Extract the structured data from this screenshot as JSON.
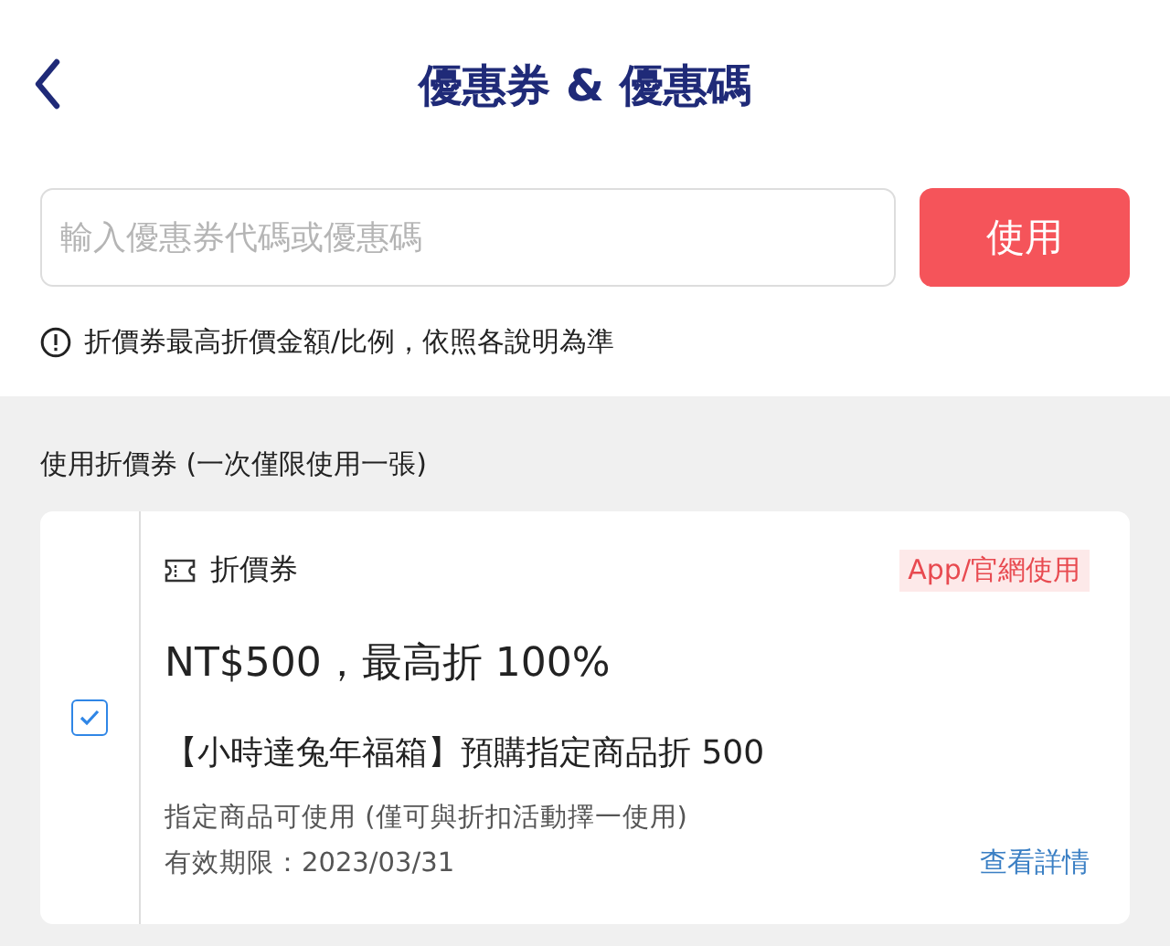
{
  "header": {
    "title": "優惠券 & 優惠碼"
  },
  "code_input": {
    "placeholder": "輸入優惠券代碼或優惠碼",
    "button": "使用"
  },
  "notice": "折價券最高折價金額/比例，依照各說明為準",
  "section": {
    "label": "使用折價券 (一次僅限使用一張)"
  },
  "coupons": [
    {
      "checked": true,
      "type": "折價券",
      "badge": "App/官網使用",
      "headline": "NT$500，最高折 100%",
      "name": "【小時達兔年福箱】預購指定商品折 500",
      "scope": "指定商品可使用 (僅可與折扣活動擇一使用)",
      "expiry": "有效期限：2023/03/31",
      "details_link": "查看詳情"
    }
  ]
}
